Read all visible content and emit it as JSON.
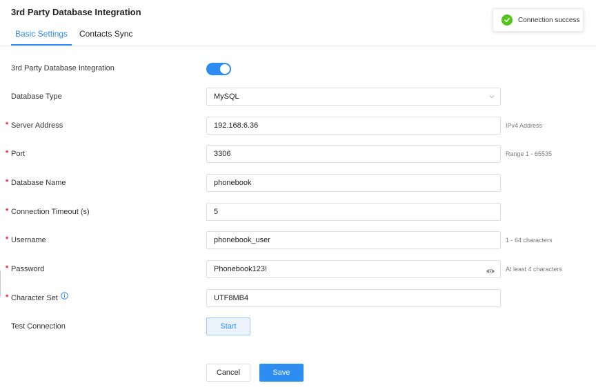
{
  "page": {
    "title": "3rd Party Database Integration"
  },
  "tabs": [
    {
      "label": "Basic Settings",
      "active": true
    },
    {
      "label": "Contacts Sync",
      "active": false
    }
  ],
  "toast": {
    "message": "Connection success",
    "icon": "check-circle-icon",
    "color": "#52c41a"
  },
  "form": {
    "integration": {
      "label": "3rd Party Database Integration",
      "enabled": true
    },
    "database_type": {
      "label": "Database Type",
      "value": "MySQL"
    },
    "server_address": {
      "label": "Server Address",
      "value": "192.168.6.36",
      "hint": "IPv4 Address",
      "required": true
    },
    "port": {
      "label": "Port",
      "value": "3306",
      "hint": "Range 1 - 65535",
      "required": true
    },
    "database_name": {
      "label": "Database Name",
      "value": "phonebook",
      "required": true
    },
    "connection_timeout": {
      "label": "Connection Timeout (s)",
      "value": "5",
      "required": true
    },
    "username": {
      "label": "Username",
      "value": "phonebook_user",
      "hint": "1 - 64 characters",
      "required": true
    },
    "password": {
      "label": "Password",
      "value": "Phonebook123!",
      "hint": "At least 4 characters",
      "required": true
    },
    "character_set": {
      "label": "Character Set",
      "value": "UTF8MB4",
      "required": true
    },
    "test_connection": {
      "label": "Test Connection",
      "button": "Start"
    }
  },
  "actions": {
    "cancel": "Cancel",
    "save": "Save"
  },
  "required_marker": "*",
  "colors": {
    "accent": "#2d8cf0",
    "required": "#e0262c",
    "success": "#52c41a"
  }
}
